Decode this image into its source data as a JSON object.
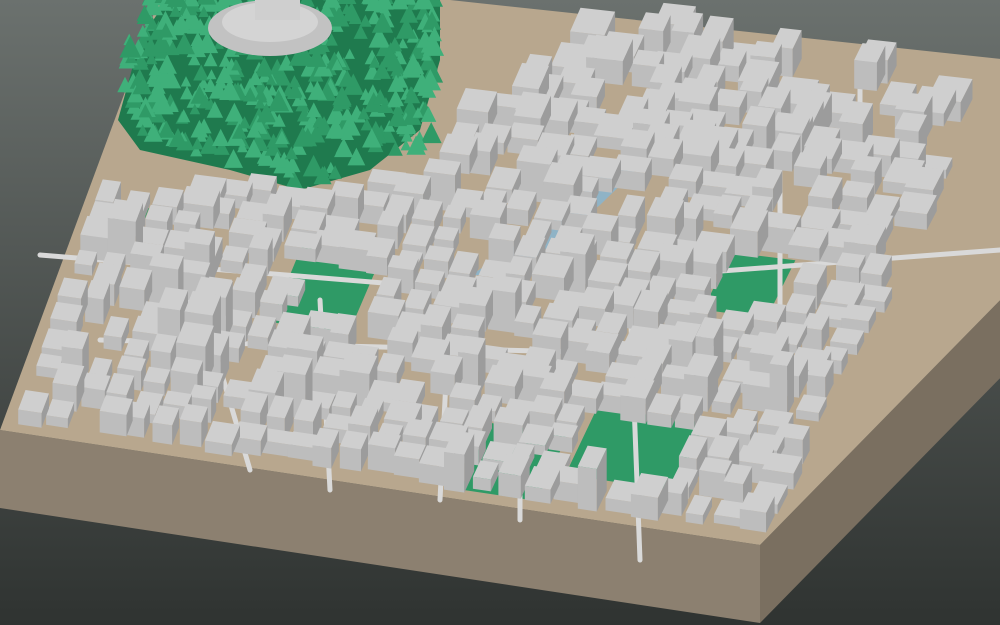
{
  "scene": {
    "type": "3d-city-block-model",
    "colors": {
      "background_top": "#6b716e",
      "background_bottom": "#2f3331",
      "base_side_front": "#8c8070",
      "base_side_right": "#7a6f60",
      "ground": "#b8a78e",
      "building_top": "#cfcfcf",
      "building_left": "#bdbdbd",
      "building_right": "#9c9c9c",
      "park": "#2f9a66",
      "park_dark": "#1f7a4e",
      "water": "#8fb3c6",
      "road": "#d9d9d9"
    }
  }
}
